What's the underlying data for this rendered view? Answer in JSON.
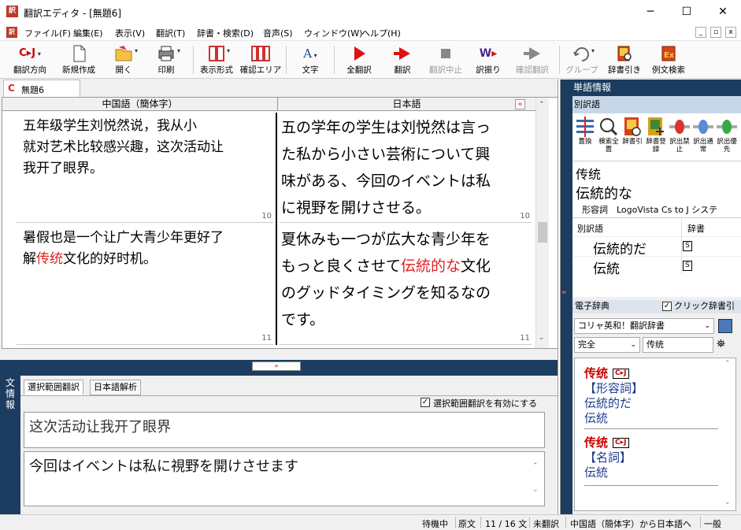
{
  "window": {
    "title": "翻訳エディタ - [無題6]",
    "app_icon": "CJ-icon",
    "controls": [
      "─",
      "☐",
      "✕"
    ]
  },
  "menu": {
    "items": [
      "ファイル(F)",
      "編集(E)",
      "表示(V)",
      "翻訳(T)",
      "辞書・検索(D)",
      "音声(S)",
      "ウィンドウ(W)",
      "ヘルプ(H)"
    ],
    "mdi_controls": [
      "_",
      "▫",
      "x"
    ]
  },
  "toolbar": {
    "buttons": [
      {
        "label": "翻訳方向",
        "icon": "direction-cj-icon",
        "enabled": true
      },
      {
        "label": "新規作成",
        "icon": "new-document-icon",
        "enabled": true
      },
      {
        "label": "開く",
        "icon": "open-folder-icon",
        "enabled": true
      },
      {
        "label": "印刷",
        "icon": "printer-icon",
        "enabled": true
      },
      {
        "label": "表示形式",
        "icon": "layout-icon",
        "enabled": true
      },
      {
        "label": "確認エリア",
        "icon": "columns-icon",
        "enabled": true
      },
      {
        "label": "文字",
        "icon": "font-icon",
        "enabled": true
      },
      {
        "label": "全翻訳",
        "icon": "play-icon",
        "enabled": true
      },
      {
        "label": "翻訳",
        "icon": "translate-icon",
        "enabled": true
      },
      {
        "label": "翻訳中止",
        "icon": "stop-icon",
        "enabled": false
      },
      {
        "label": "訳振り",
        "icon": "furigana-icon",
        "enabled": true
      },
      {
        "label": "確認翻訳",
        "icon": "confirm-icon",
        "enabled": false
      },
      {
        "label": "グループ",
        "icon": "group-icon",
        "enabled": false
      },
      {
        "label": "辞書引き",
        "icon": "dictionary-lookup-icon",
        "enabled": true
      },
      {
        "label": "例文検索",
        "icon": "example-search-icon",
        "enabled": true
      }
    ]
  },
  "document": {
    "tab_label": "無題6",
    "tab_icon": "C",
    "col_source": "中国語（簡体字）",
    "col_target": "日本語",
    "collapse_glyph": "«",
    "rows": [
      {
        "source_lines": [
          "五年级学生刘悦然说，我从小",
          "就对艺术比较感兴趣，这次活动让",
          "我开了眼界。"
        ],
        "target_lines": [
          "五の学年の学生は刘悦然は言っ",
          "た私から小さい芸術について興",
          "味がある、今回のイベントは私",
          "に視野を開けさせる。"
        ],
        "line_no": "10"
      },
      {
        "source_pre": "暑假也是一个让广大青少年更好了",
        "source_line2_a": "解",
        "source_highlight": "传统",
        "source_line2_b": "文化的好时机。",
        "target_line1": "夏休みも一つが広大な青少年を",
        "target_line2_a": "もっと良くさせて",
        "target_highlight": "伝統的な",
        "target_line2_b": "文化",
        "target_line3": "のグッドタイミングを知るなの",
        "target_line4": "です。",
        "line_no": "11"
      }
    ]
  },
  "lower": {
    "side_label_chars": [
      "文",
      "情",
      "報"
    ],
    "expand_glyph": "»",
    "tabs": [
      "選択範囲翻訳",
      "日本語解析"
    ],
    "enable_checkbox_label": "選択範囲翻訳を有効にする",
    "enable_checked": true,
    "source_text": "这次活动让我开了眼界",
    "target_text": "今回はイベントは私に視野を開けさせます"
  },
  "word_info": {
    "header": "単語情報",
    "sub_header": "別訳語",
    "tools": [
      {
        "label": "置換",
        "icon": "replace-icon"
      },
      {
        "label": "検索全置",
        "icon": "search-replace-all-icon"
      },
      {
        "label": "辞書引",
        "icon": "dictionary-icon"
      },
      {
        "label": "辞書登録",
        "icon": "dictionary-register-icon"
      },
      {
        "label": "訳出禁止",
        "icon": "ban-translation-icon"
      },
      {
        "label": "訳出通常",
        "icon": "normal-translation-icon"
      },
      {
        "label": "訳出優先",
        "icon": "priority-translation-icon"
      }
    ],
    "source_word": "传统",
    "translation": "伝統的な",
    "pos": "形容詞",
    "dict_name": "LogoVista Cs to J システ",
    "table_headers": [
      "別訳語",
      "辞書"
    ],
    "alternatives": [
      {
        "word": "伝統的だ",
        "dict": "S"
      },
      {
        "word": "伝統",
        "dict": "S"
      }
    ],
    "expand_glyph": "»"
  },
  "e_dict": {
    "header": "電子辞典",
    "click_lookup_label": "クリック辞書引",
    "click_lookup_checked": true,
    "dictionary_select": "コリャ英和！翻訳辞書",
    "match_select": "完全",
    "query": "传统",
    "entries": [
      {
        "headword": "传统",
        "tag": "C▸J",
        "pos": "【形容詞】",
        "meanings": [
          "伝統的だ",
          "伝統"
        ]
      },
      {
        "headword": "传统",
        "tag": "C▸J",
        "pos": "【名詞】",
        "meanings": [
          "伝統"
        ]
      }
    ]
  },
  "status": {
    "items": [
      "待機中",
      "原文",
      "11 / 16 文",
      "未翻訳",
      "中国語（簡体字）から日本語へ",
      "一般"
    ]
  },
  "colors": {
    "navy": "#1c3d60",
    "highlight": "#dd2222",
    "link_blue": "#1e3a8a"
  }
}
